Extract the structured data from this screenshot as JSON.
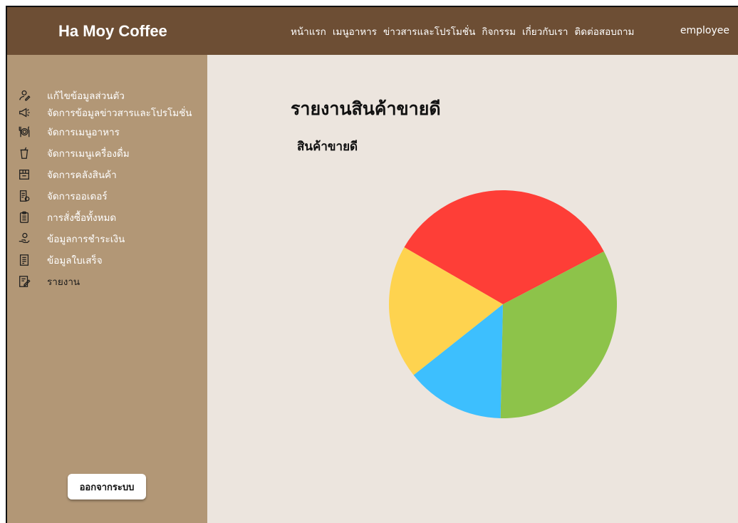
{
  "header": {
    "brand": "Ha Moy Coffee",
    "nav": [
      "หน้าแรก",
      "เมนูอาหาร",
      "ข่าวสารและโปรโมชั่น",
      "กิจกรรม",
      "เกี่ยวกับเรา",
      "ติดต่อสอบถาม"
    ],
    "user": "employee"
  },
  "sidebar": {
    "items": [
      {
        "label": "แก้ไขข้อมูลส่วนตัว",
        "icon": "edit-profile-icon"
      },
      {
        "label": "จัดการข้อมูลข่าวสารและโปรโมชั่น",
        "icon": "megaphone-icon"
      },
      {
        "label": "จัดการเมนูอาหาร",
        "icon": "utensils-icon"
      },
      {
        "label": "จัดการเมนูเครื่องดื่ม",
        "icon": "drink-cup-icon"
      },
      {
        "label": "จัดการคลังสินค้า",
        "icon": "warehouse-box-icon"
      },
      {
        "label": "จัดการออเดอร์",
        "icon": "order-list-icon"
      },
      {
        "label": "การสั่งซื้อทั้งหมด",
        "icon": "clipboard-icon"
      },
      {
        "label": "ข้อมูลการชำระเงิน",
        "icon": "payment-hand-icon"
      },
      {
        "label": "ข้อมูลใบเสร็จ",
        "icon": "receipt-icon"
      },
      {
        "label": "รายงาน",
        "icon": "report-icon"
      }
    ],
    "logout": "ออกจากระบบ"
  },
  "main": {
    "title": "รายงานสินค้าขายดี",
    "subtitle": "สินค้าขายดี"
  },
  "chart_data": {
    "type": "pie",
    "title": "",
    "values": [
      34,
      33,
      14,
      19
    ],
    "colors": [
      "#fe3e37",
      "#8dc34a",
      "#3dbffe",
      "#fed34f"
    ],
    "legend": "none"
  }
}
